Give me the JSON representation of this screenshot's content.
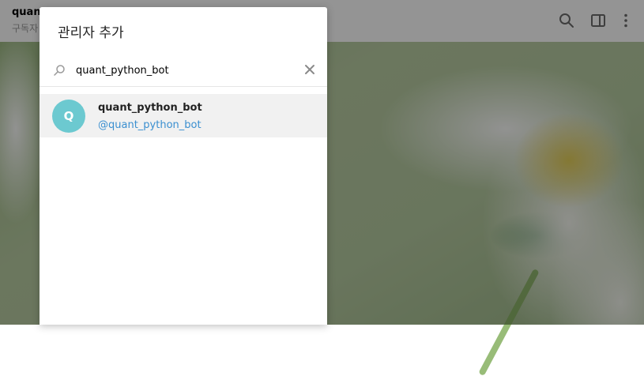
{
  "chat_header": {
    "title": "quant",
    "subtitle": "구독자"
  },
  "dialog": {
    "title": "관리자 추가",
    "search": {
      "value": "quant_python_bot",
      "placeholder": ""
    },
    "results": [
      {
        "avatar_letter": "Q",
        "name": "quant_python_bot",
        "handle": "@quant_python_bot"
      }
    ]
  },
  "colors": {
    "avatar": "#6cc9d0",
    "handle": "#3a8fd0",
    "selected_row": "#f1f1f1"
  },
  "icons": [
    "search-icon",
    "sidebar-toggle-icon",
    "more-vertical-icon",
    "search-small-icon",
    "close-icon"
  ]
}
